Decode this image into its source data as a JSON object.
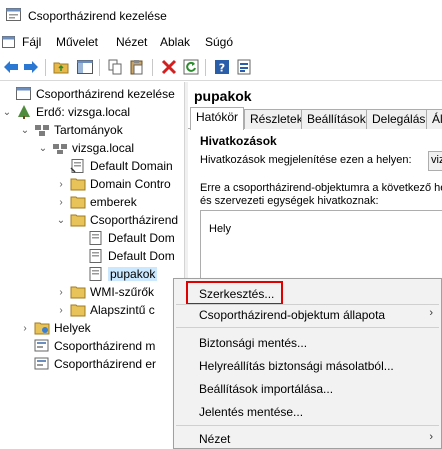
{
  "window": {
    "title": "Csoportházirend kezelése"
  },
  "menu": [
    "Fájl",
    "Művelet",
    "Nézet",
    "Ablak",
    "Súgó"
  ],
  "toolbar": {
    "icons": [
      "back-arrow-icon",
      "forward-arrow-icon",
      "up-folder-icon",
      "show-hide-tree-icon",
      "copy-icon",
      "paste-icon",
      "delete-icon",
      "refresh-icon",
      "help-icon",
      "properties-icon"
    ]
  },
  "tree": {
    "items": [
      {
        "label": "Csoportházirend kezelése",
        "chev": ""
      },
      {
        "label": "Erdő: vizsga.local",
        "chev": "⌄"
      },
      {
        "label": "Tartományok",
        "chev": "⌄"
      },
      {
        "label": "vizsga.local",
        "chev": "⌄"
      },
      {
        "label": "Default Domain",
        "chev": ""
      },
      {
        "label": "Domain Contro",
        "chev": "›"
      },
      {
        "label": "emberek",
        "chev": "›"
      },
      {
        "label": "Csoportházirend",
        "chev": "⌄"
      },
      {
        "label": "Default Dom",
        "chev": ""
      },
      {
        "label": "Default Dom",
        "chev": ""
      },
      {
        "label": "pupakok",
        "chev": ""
      },
      {
        "label": "WMI-szűrők",
        "chev": "›"
      },
      {
        "label": "Alapszintű c",
        "chev": "›"
      },
      {
        "label": "Helyek",
        "chev": "›"
      },
      {
        "label": "Csoportházirend m",
        "chev": ""
      },
      {
        "label": "Csoportházirend er",
        "chev": ""
      }
    ]
  },
  "details": {
    "heading": "pupakok",
    "tabs": [
      "Hatókör",
      "Részletek",
      "Beállítások",
      "Delegálás",
      "Ál"
    ],
    "section_title": "Hivatkozások",
    "show_label": "Hivatkozások megjelenítése ezen a helyen:",
    "combo_value": "viz",
    "description_line1": "Erre a csoportházirend-objektumra a következő hely",
    "description_line2": "és szervezeti egységek hivatkoznak:",
    "list_column": "Hely"
  },
  "context_menu": {
    "items": [
      {
        "label": "Szerkesztés...",
        "submenu": false
      },
      {
        "label": "Csoportházirend-objektum állapota",
        "submenu": true
      },
      {
        "label": "Biztonsági mentés...",
        "submenu": false
      },
      {
        "label": "Helyreállítás biztonsági másolatból...",
        "submenu": false
      },
      {
        "label": "Beállítások importálása...",
        "submenu": false
      },
      {
        "label": "Jelentés mentése...",
        "submenu": false
      },
      {
        "label": "Nézet",
        "submenu": true
      }
    ],
    "submenu_arrow": "›"
  },
  "colors": {
    "selection": "#cce8ff",
    "highlight_box": "#e00000",
    "menu_bg": "#f2f2f2"
  }
}
